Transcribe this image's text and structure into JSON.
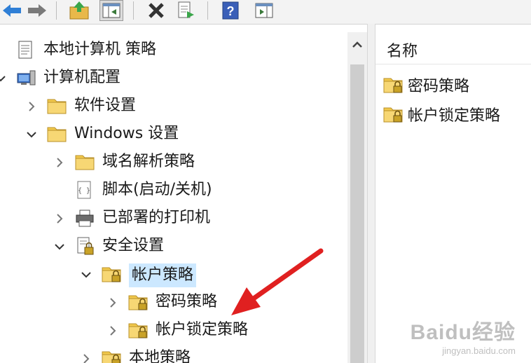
{
  "toolbar": {
    "buttons": [
      {
        "name": "back-button",
        "icon": "back-arrow-icon"
      },
      {
        "name": "forward-button",
        "icon": "forward-arrow-icon"
      },
      {
        "name": "up-folder-button",
        "icon": "folder-up-icon"
      },
      {
        "name": "show-hide-tree-button",
        "icon": "console-tree-icon"
      },
      {
        "name": "delete-button",
        "icon": "delete-x-icon"
      },
      {
        "name": "export-list-button",
        "icon": "export-list-icon"
      },
      {
        "name": "help-button",
        "icon": "help-icon",
        "glyph": "?"
      },
      {
        "name": "show-action-pane-button",
        "icon": "action-pane-icon"
      }
    ]
  },
  "tree": [
    {
      "label": "本地计算机 策略",
      "icon": "policy-document-icon",
      "chevron": "none"
    },
    {
      "label": "计算机配置",
      "icon": "computer-icon",
      "chevron": "down"
    },
    {
      "label": "软件设置",
      "icon": "folder-icon",
      "chevron": "right"
    },
    {
      "label": "Windows 设置",
      "icon": "folder-icon",
      "chevron": "down"
    },
    {
      "label": "域名解析策略",
      "icon": "folder-icon",
      "chevron": "right"
    },
    {
      "label": "脚本(启动/关机)",
      "icon": "script-icon",
      "chevron": "none"
    },
    {
      "label": "已部署的打印机",
      "icon": "printer-icon",
      "chevron": "right"
    },
    {
      "label": "安全设置",
      "icon": "security-settings-icon",
      "chevron": "down"
    },
    {
      "label": "帐户策略",
      "icon": "secure-folder-icon",
      "chevron": "down",
      "selected": true
    },
    {
      "label": "密码策略",
      "icon": "secure-folder-icon",
      "chevron": "right"
    },
    {
      "label": "帐户锁定策略",
      "icon": "secure-folder-icon",
      "chevron": "right"
    },
    {
      "label": "本地策略",
      "icon": "secure-folder-icon",
      "chevron": "right"
    }
  ],
  "list": {
    "column_header": "名称",
    "items": [
      {
        "label": "密码策略",
        "icon": "secure-folder-icon"
      },
      {
        "label": "帐户锁定策略",
        "icon": "secure-folder-icon"
      }
    ]
  },
  "colors": {
    "selection": "#cce8ff",
    "folder": "#f2c94c",
    "arrow": "#e02020",
    "back_arrow": "#2f7fd6"
  },
  "watermark": {
    "brand": "Baidu经验",
    "url": "jingyan.baidu.com"
  }
}
